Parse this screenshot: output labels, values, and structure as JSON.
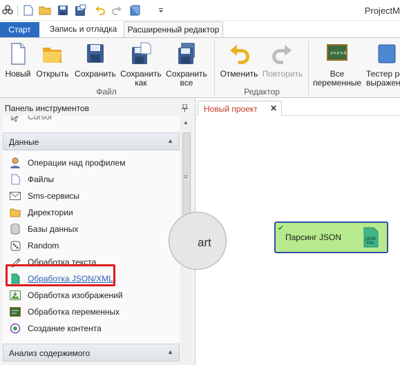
{
  "app": {
    "title": "ProjectM"
  },
  "tabs": [
    "Старт",
    "Запись и отладка",
    "Расширенный редактор"
  ],
  "ribbon": {
    "file_group": "Файл",
    "editor_group": "Редактор",
    "new": "Новый",
    "open": "Открыть",
    "save": "Сохранить",
    "save_as_1": "Сохранить",
    "save_as_2": "как",
    "save_all_1": "Сохранить",
    "save_all_2": "все",
    "undo": "Отменить",
    "redo": "Повторить",
    "all_vars_1": "Все",
    "all_vars_2": "переменные",
    "tester_1": "Тестер ре",
    "tester_2": "выражен"
  },
  "panel": {
    "title": "Панель инструментов",
    "clipped_item": "Cursor",
    "section_data": "Данные",
    "items": [
      "Операции над профилем",
      "Файлы",
      "Sms-сервисы",
      "Директории",
      "Базы данных",
      "Random",
      "Обработка текста",
      "Обработка JSON/XML",
      "Обработка изображений",
      "Обработка переменных",
      "Создание контента"
    ],
    "section_analysis": "Анализ содержимого"
  },
  "document": {
    "tab": "Новый проект"
  },
  "canvas": {
    "start_label": "art",
    "json_node_label": "Парсинг JSON",
    "json_icon_text_1": "JSON",
    "json_icon_text_2": "XML"
  },
  "colors": {
    "accent": "#2a6bc4",
    "highlight": "#e01b1b",
    "node_fill": "#b7ea8e",
    "node_border": "#2e4fa7",
    "link": "#2a5fb8"
  }
}
